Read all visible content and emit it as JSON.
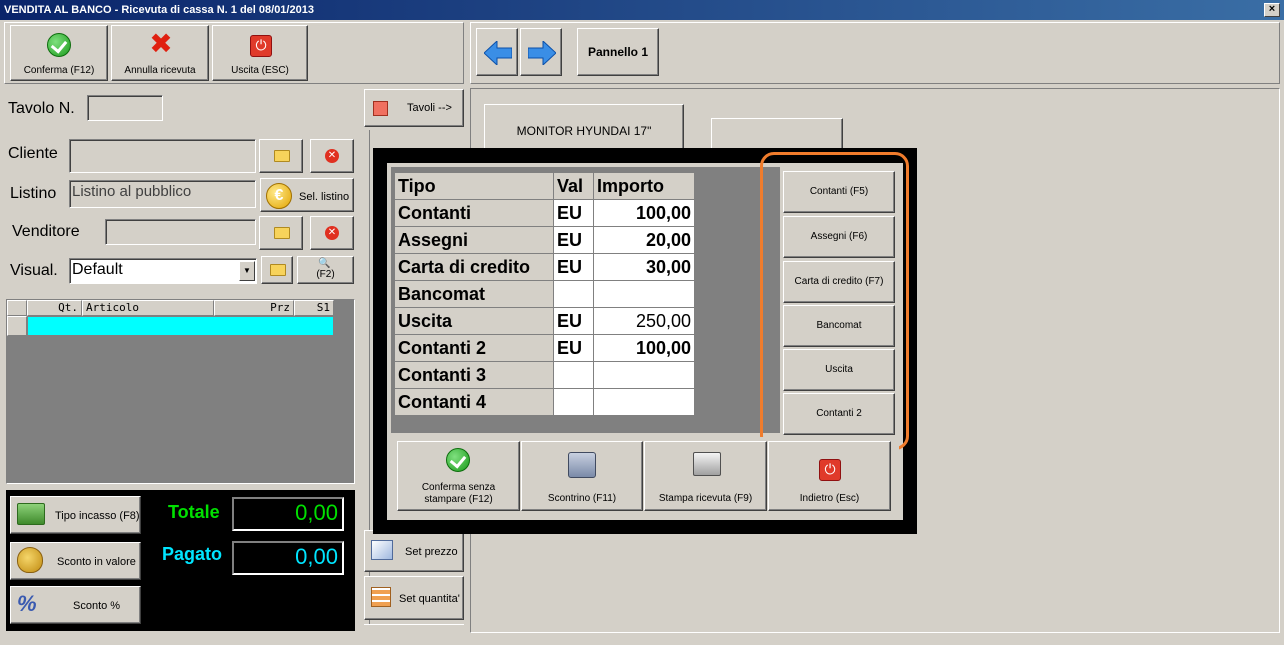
{
  "window": {
    "title": "VENDITA AL BANCO - Ricevuta di cassa N. 1 del 08/01/2013",
    "close_glyph": "×"
  },
  "toolbar": {
    "confirm_label": "Conferma (F12)",
    "cancel_label": "Annulla ricevuta",
    "exit_label": "Uscita (ESC)"
  },
  "nav": {
    "prev_icon": "arrow-left-icon",
    "next_icon": "arrow-right-icon",
    "panel_label": "Pannello 1"
  },
  "form": {
    "tavolo_label": "Tavolo N.",
    "tavolo_value": "",
    "tavoli_button": "Tavoli -->",
    "cliente_label": "Cliente",
    "cliente_value": "",
    "listino_label": "Listino",
    "listino_value": "Listino al pubblico",
    "sel_listino_label": "Sel. listino",
    "venditore_label": "Venditore",
    "venditore_value": "",
    "visual_label": "Visual.",
    "visual_value": "Default",
    "f2_label": "(F2)"
  },
  "items_grid": {
    "columns": [
      "Qt.",
      "Articolo",
      "Prz",
      "S1"
    ]
  },
  "totals": {
    "tipo_incasso_label": "Tipo incasso (F8)",
    "sconto_valore_label": "Sconto in valore",
    "sconto_pct_label": "Sconto %",
    "totale_label": "Totale",
    "totale_value": "0,00",
    "pagato_label": "Pagato",
    "pagato_value": "0,00",
    "totale_color": "#00e000",
    "pagato_color": "#00e5ff"
  },
  "right_panel": {
    "product_button": "MONITOR HYUNDAI 17\"",
    "set_prezzo_label": "Set prezzo",
    "set_quantita_label": "Set quantita'"
  },
  "payment_dialog": {
    "headers": {
      "tipo": "Tipo",
      "val": "Val",
      "importo": "Importo"
    },
    "rows": [
      {
        "tipo": "Contanti",
        "val": "EU",
        "importo": "100,00"
      },
      {
        "tipo": "Assegni",
        "val": "EU",
        "importo": "20,00"
      },
      {
        "tipo": "Carta di credito",
        "val": "EU",
        "importo": "30,00"
      },
      {
        "tipo": "Bancomat",
        "val": "",
        "importo": ""
      },
      {
        "tipo": "Uscita",
        "val": "EU",
        "importo": "250,00"
      },
      {
        "tipo": "Contanti 2",
        "val": "EU",
        "importo": "100,00"
      },
      {
        "tipo": "Contanti 3",
        "val": "",
        "importo": ""
      },
      {
        "tipo": "Contanti 4",
        "val": "",
        "importo": ""
      }
    ],
    "side_buttons": [
      "Contanti (F5)",
      "Assegni (F6)",
      "Carta di credito (F7)",
      "Bancomat",
      "Uscita",
      "Contanti 2"
    ],
    "highlight_color": "#f07c2c",
    "bottom_buttons": {
      "confirm_no_print_line1": "Conferma senza",
      "confirm_no_print_line2": "stampare (F12)",
      "scontrino": "Scontrino (F11)",
      "stampa_ricevuta": "Stampa ricevuta (F9)",
      "indietro": "Indietro (Esc)"
    }
  }
}
